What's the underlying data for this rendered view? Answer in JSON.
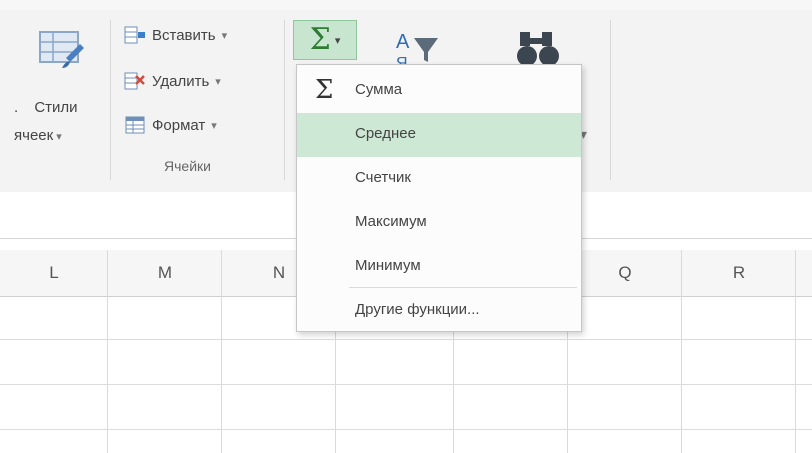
{
  "ribbon": {
    "styles_button": {
      "line1": "Стили",
      "line2": "ячеек",
      "left_fragment": "."
    },
    "cells_group": {
      "insert_label": "Вставить",
      "delete_label": "Удалить",
      "format_label": "Формат",
      "group_label": "Ячейки"
    },
    "autosum_icon": "sigma-icon",
    "sort_icon": "sort-filter-icon",
    "find_icon": "binoculars-icon"
  },
  "autosum_menu": {
    "items": [
      {
        "label": "Сумма",
        "icon": "sigma-icon"
      },
      {
        "label": "Среднее"
      },
      {
        "label": "Счетчик"
      },
      {
        "label": "Максимум"
      },
      {
        "label": "Минимум"
      }
    ],
    "more_functions_label": "Другие функции...",
    "highlighted_index": 1
  },
  "grid": {
    "columns": [
      "L",
      "M",
      "N",
      "Q",
      "R"
    ]
  },
  "colors": {
    "accent_green": "#2e7d32",
    "highlight": "#cde8d4"
  }
}
